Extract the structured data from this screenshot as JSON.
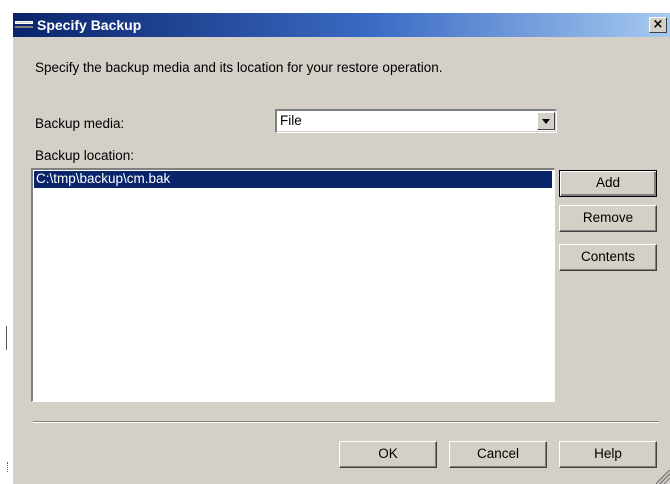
{
  "window": {
    "title": "Specify Backup",
    "close_glyph": "×"
  },
  "instructions": "Specify the backup media and its location for your restore operation.",
  "backup_media": {
    "label": "Backup media:",
    "selected": "File"
  },
  "backup_location": {
    "label": "Backup location:",
    "items": [
      "C:\\tmp\\backup\\cm.bak"
    ],
    "selected_index": 0
  },
  "side_buttons": {
    "add": "Add",
    "remove": "Remove",
    "contents": "Contents"
  },
  "footer_buttons": {
    "ok": "OK",
    "cancel": "Cancel",
    "help": "Help"
  },
  "colors": {
    "dialog_bg": "#d4d0c8",
    "title_start": "#0a246a",
    "title_end": "#a6caf0",
    "selection": "#0a246a"
  }
}
